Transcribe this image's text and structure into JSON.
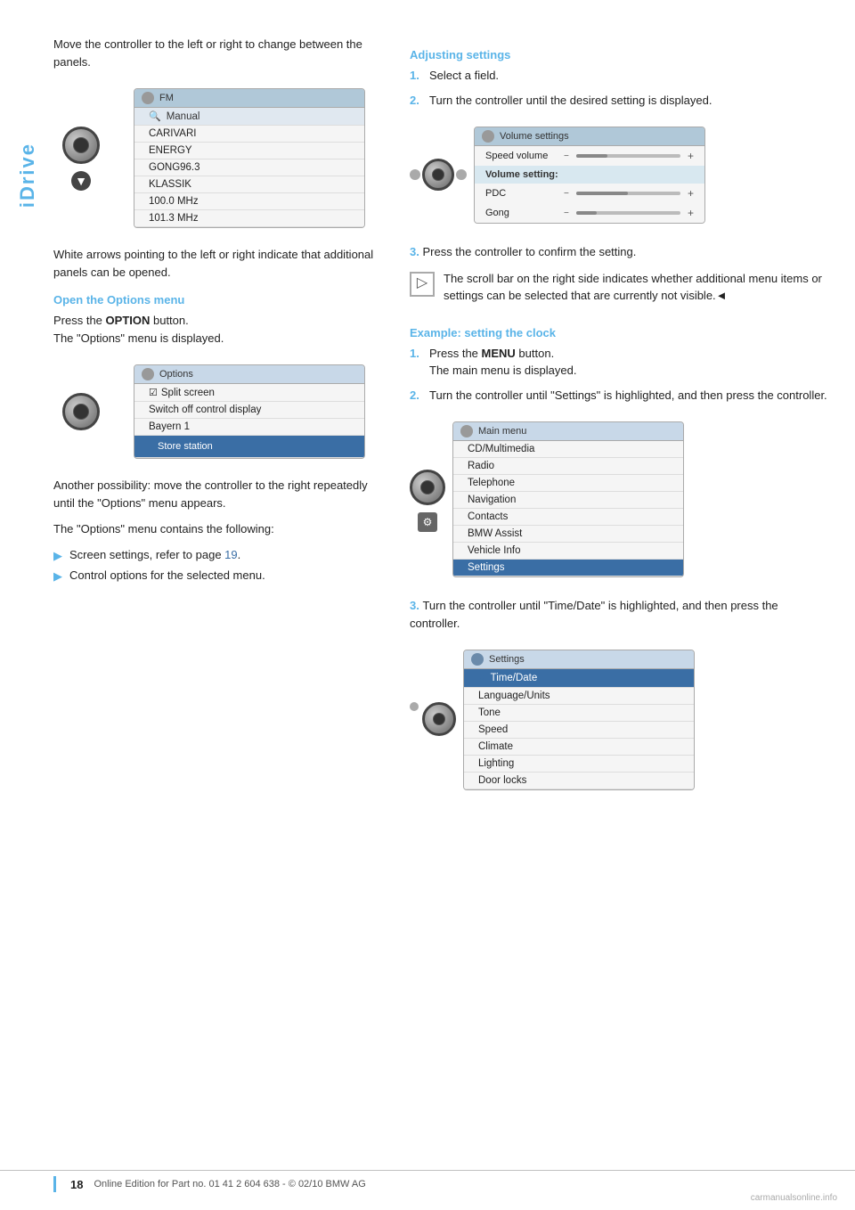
{
  "page": {
    "title": "iDrive",
    "page_number": "18",
    "footer_text": "Online Edition for Part no. 01 41 2 604 638 - © 02/10 BMW AG"
  },
  "left_column": {
    "intro_text": "Move the controller to the left or right to change between the panels.",
    "fm_screen": {
      "title": "FM",
      "items": [
        {
          "label": "Manual",
          "type": "search"
        },
        {
          "label": "CARIVARI",
          "type": "normal"
        },
        {
          "label": "ENERGY",
          "type": "normal"
        },
        {
          "label": "GONG96.3",
          "type": "normal"
        },
        {
          "label": "KLASSIK",
          "type": "normal"
        },
        {
          "label": "100.0 MHz",
          "type": "normal"
        },
        {
          "label": "101.3 MHz",
          "type": "normal"
        }
      ]
    },
    "white_arrows_text": "White arrows pointing to the left or right indicate that additional panels can be opened.",
    "open_options_heading": "Open the Options menu",
    "open_options_text1": "Press the ",
    "open_options_bold": "OPTION",
    "open_options_text2": " button.",
    "open_options_text3": "The \"Options\" menu is displayed.",
    "options_screen": {
      "title": "Options",
      "items": [
        {
          "label": "Split screen",
          "type": "check"
        },
        {
          "label": "Switch off control display",
          "type": "normal"
        },
        {
          "label": "Bayern 1",
          "type": "normal"
        },
        {
          "label": "Store station",
          "type": "highlighted"
        }
      ]
    },
    "another_possibility_text": "Another possibility: move the controller to the right repeatedly until the \"Options\" menu appears.",
    "options_contains_text": "The \"Options\" menu contains the following:",
    "bullet_items": [
      "Screen settings, refer to page 19.",
      "Control options for the selected menu."
    ]
  },
  "right_column": {
    "adjusting_heading": "Adjusting settings",
    "adjusting_steps": [
      "Select a field.",
      "Turn the controller until the desired setting is displayed."
    ],
    "volume_screen": {
      "title": "Volume settings",
      "items": [
        {
          "label": "Speed volume",
          "type": "slider",
          "fill": 30
        },
        {
          "label": "Volume setting:",
          "type": "section"
        },
        {
          "label": "PDC",
          "type": "slider",
          "fill": 50
        },
        {
          "label": "Gong",
          "type": "slider",
          "fill": 20
        }
      ]
    },
    "step3_text": "Press the controller to confirm the setting.",
    "scroll_indicator_text": "The scroll bar on the right side indicates whether additional menu items or settings can be selected that are currently not visible.◄",
    "example_heading": "Example: setting the clock",
    "example_steps": [
      {
        "num": "1.",
        "text1": "Press the ",
        "bold": "MENU",
        "text2": " button.\nThe main menu is displayed."
      },
      {
        "num": "2.",
        "text": "Turn the controller until \"Settings\" is highlighted, and then press the controller."
      }
    ],
    "main_menu_screen": {
      "title": "Main menu",
      "items": [
        {
          "label": "CD/Multimedia",
          "type": "normal"
        },
        {
          "label": "Radio",
          "type": "normal"
        },
        {
          "label": "Telephone",
          "type": "normal"
        },
        {
          "label": "Navigation",
          "type": "normal"
        },
        {
          "label": "Contacts",
          "type": "normal"
        },
        {
          "label": "BMW Assist",
          "type": "normal"
        },
        {
          "label": "Vehicle Info",
          "type": "normal"
        },
        {
          "label": "Settings",
          "type": "highlighted"
        }
      ]
    },
    "step3b_text": "Turn the controller until \"Time/Date\" is highlighted, and then press the controller.",
    "settings_screen": {
      "title": "Settings",
      "items": [
        {
          "label": "Time/Date",
          "type": "highlighted",
          "check": true
        },
        {
          "label": "Language/Units",
          "type": "normal"
        },
        {
          "label": "Tone",
          "type": "normal"
        },
        {
          "label": "Speed",
          "type": "normal"
        },
        {
          "label": "Climate",
          "type": "normal"
        },
        {
          "label": "Lighting",
          "type": "normal"
        },
        {
          "label": "Door locks",
          "type": "normal"
        }
      ]
    }
  }
}
